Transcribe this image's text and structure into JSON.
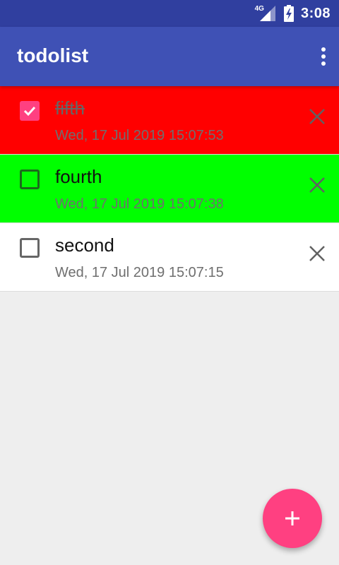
{
  "status_bar": {
    "network": "4G",
    "time": "3:08",
    "icons": [
      "network-4g-icon",
      "signal-icon",
      "battery-charging-icon"
    ]
  },
  "app_bar": {
    "title": "todolist",
    "menu_icon": "overflow-menu-icon"
  },
  "todos": [
    {
      "title": "fifth",
      "date": "Wed, 17 Jul 2019 15:07:53",
      "checked": true,
      "color": "#ff0000"
    },
    {
      "title": "fourth",
      "date": "Wed, 17 Jul 2019 15:07:38",
      "checked": false,
      "color": "#00ff00"
    },
    {
      "title": "second",
      "date": "Wed, 17 Jul 2019 15:07:15",
      "checked": false,
      "color": "#ffffff"
    }
  ],
  "fab": {
    "icon": "plus-icon",
    "color": "#ff4081"
  },
  "colors": {
    "primary_dark": "#303f9f",
    "primary": "#3f51b5",
    "accent": "#ff4081",
    "background": "#eeeeee"
  }
}
